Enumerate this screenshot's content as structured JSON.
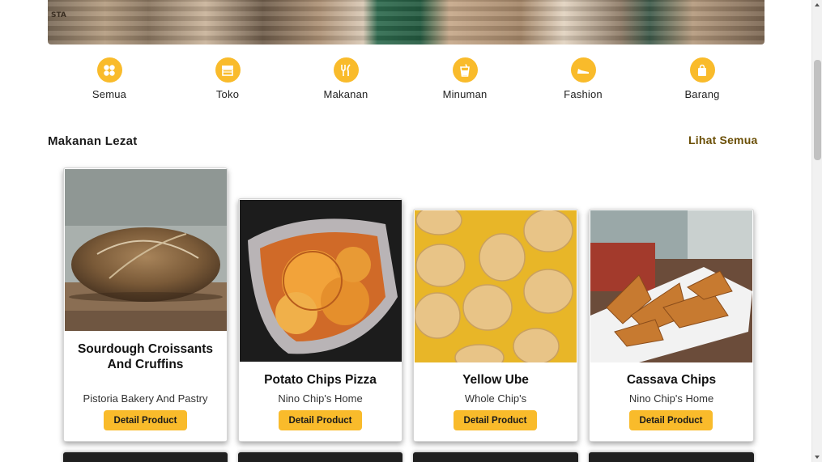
{
  "hero": {
    "label": "STA"
  },
  "categories": [
    {
      "label": "Semua",
      "icon": "grid-icon"
    },
    {
      "label": "Toko",
      "icon": "store-icon"
    },
    {
      "label": "Makanan",
      "icon": "fork-knife-icon"
    },
    {
      "label": "Minuman",
      "icon": "cup-icon"
    },
    {
      "label": "Fashion",
      "icon": "shoe-icon"
    },
    {
      "label": "Barang",
      "icon": "bag-icon"
    }
  ],
  "section": {
    "title": "Makanan Lezat",
    "see_all": "Lihat Semua"
  },
  "products": [
    {
      "name": "Sourdough Croissants And Cruffins",
      "shop": "Pistoria Bakery And Pastry",
      "button": "Detail Product"
    },
    {
      "name": "Potato Chips Pizza",
      "shop": "Nino Chip's Home",
      "button": "Detail Product"
    },
    {
      "name": "Yellow Ube",
      "shop": "Whole Chip's",
      "button": "Detail Product"
    },
    {
      "name": "Cassava Chips",
      "shop": "Nino Chip's Home",
      "button": "Detail Product"
    }
  ],
  "colors": {
    "accent": "#f9bb2b",
    "link": "#6b4f06"
  }
}
